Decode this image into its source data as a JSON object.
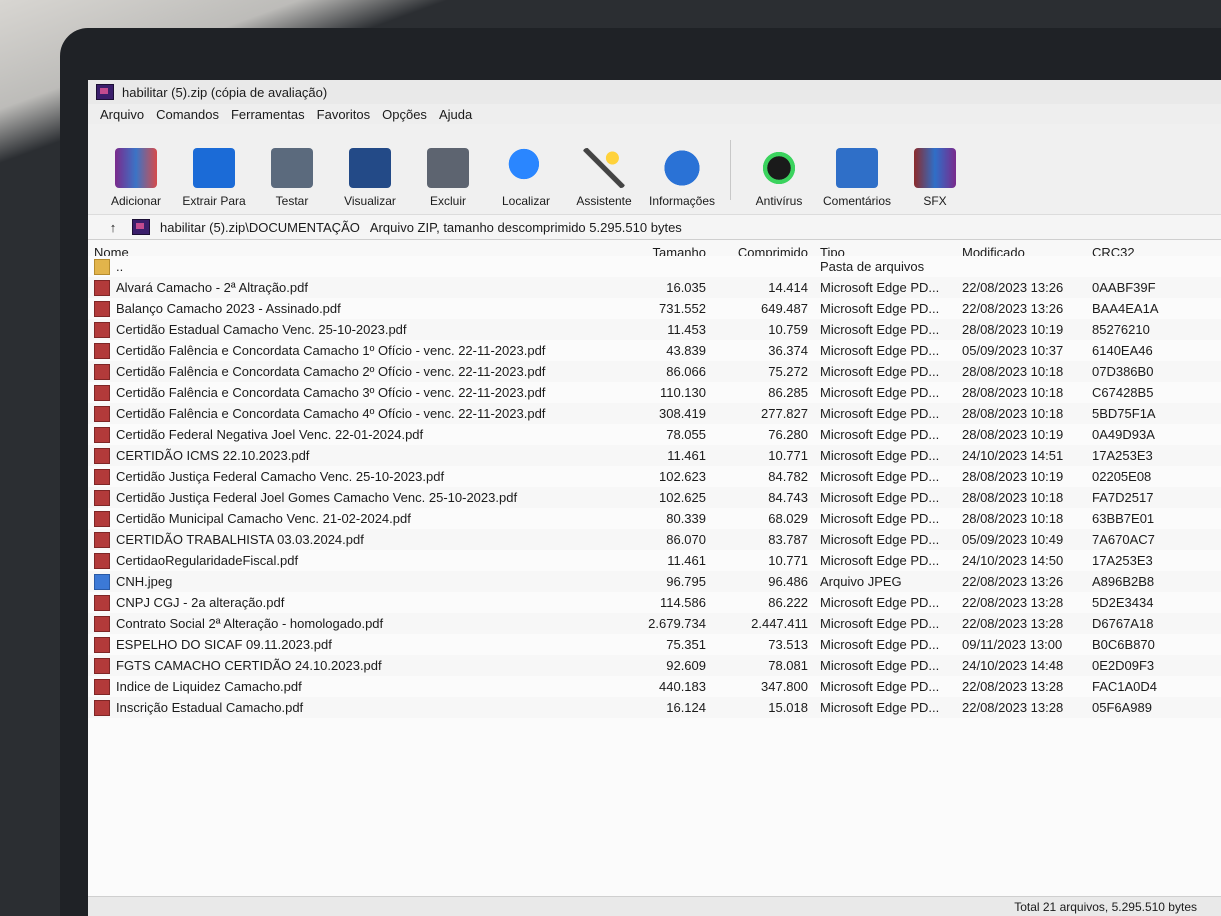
{
  "window": {
    "title": "habilitar (5).zip (cópia de avaliação)"
  },
  "menu": [
    "Arquivo",
    "Comandos",
    "Ferramentas",
    "Favoritos",
    "Opções",
    "Ajuda"
  ],
  "toolbar": [
    {
      "label": "Adicionar",
      "icon": "add-icon"
    },
    {
      "label": "Extrair Para",
      "icon": "extract-icon"
    },
    {
      "label": "Testar",
      "icon": "test-icon"
    },
    {
      "label": "Visualizar",
      "icon": "view-icon"
    },
    {
      "label": "Excluir",
      "icon": "delete-icon"
    },
    {
      "label": "Localizar",
      "icon": "search-icon"
    },
    {
      "label": "Assistente",
      "icon": "wizard-icon"
    },
    {
      "label": "Informações",
      "icon": "info-icon"
    },
    {
      "label": "Antivírus",
      "icon": "antivirus-icon"
    },
    {
      "label": "Comentários",
      "icon": "comment-icon"
    },
    {
      "label": "SFX",
      "icon": "sfx-icon"
    }
  ],
  "path": {
    "location": "habilitar (5).zip\\DOCUMENTAÇÃO",
    "info": "Arquivo ZIP, tamanho descomprimido 5.295.510 bytes"
  },
  "columns": [
    "Nome",
    "Tamanho",
    "Comprimido",
    "Tipo",
    "Modificado",
    "CRC32"
  ],
  "files": [
    {
      "name": "..",
      "size": "",
      "compressed": "",
      "type": "Pasta de arquivos",
      "modified": "",
      "crc": "",
      "kind": "folder"
    },
    {
      "name": "Alvará Camacho - 2ª Altração.pdf",
      "size": "16.035",
      "compressed": "14.414",
      "type": "Microsoft Edge PD...",
      "modified": "22/08/2023 13:26",
      "crc": "0AABF39F",
      "kind": "pdf"
    },
    {
      "name": "Balanço Camacho 2023 - Assinado.pdf",
      "size": "731.552",
      "compressed": "649.487",
      "type": "Microsoft Edge PD...",
      "modified": "22/08/2023 13:26",
      "crc": "BAA4EA1A",
      "kind": "pdf"
    },
    {
      "name": "Certidão Estadual Camacho Venc. 25-10-2023.pdf",
      "size": "11.453",
      "compressed": "10.759",
      "type": "Microsoft Edge PD...",
      "modified": "28/08/2023 10:19",
      "crc": "85276210",
      "kind": "pdf"
    },
    {
      "name": "Certidão Falência e Concordata Camacho 1º Ofício - venc. 22-11-2023.pdf",
      "size": "43.839",
      "compressed": "36.374",
      "type": "Microsoft Edge PD...",
      "modified": "05/09/2023 10:37",
      "crc": "6140EA46",
      "kind": "pdf"
    },
    {
      "name": "Certidão Falência e Concordata Camacho 2º Ofício - venc. 22-11-2023.pdf",
      "size": "86.066",
      "compressed": "75.272",
      "type": "Microsoft Edge PD...",
      "modified": "28/08/2023 10:18",
      "crc": "07D386B0",
      "kind": "pdf"
    },
    {
      "name": "Certidão Falência e Concordata Camacho 3º Ofício - venc. 22-11-2023.pdf",
      "size": "110.130",
      "compressed": "86.285",
      "type": "Microsoft Edge PD...",
      "modified": "28/08/2023 10:18",
      "crc": "C67428B5",
      "kind": "pdf"
    },
    {
      "name": "Certidão Falência e Concordata Camacho 4º Ofício - venc. 22-11-2023.pdf",
      "size": "308.419",
      "compressed": "277.827",
      "type": "Microsoft Edge PD...",
      "modified": "28/08/2023 10:18",
      "crc": "5BD75F1A",
      "kind": "pdf"
    },
    {
      "name": "Certidão Federal Negativa Joel Venc. 22-01-2024.pdf",
      "size": "78.055",
      "compressed": "76.280",
      "type": "Microsoft Edge PD...",
      "modified": "28/08/2023 10:19",
      "crc": "0A49D93A",
      "kind": "pdf"
    },
    {
      "name": "CERTIDÃO ICMS 22.10.2023.pdf",
      "size": "11.461",
      "compressed": "10.771",
      "type": "Microsoft Edge PD...",
      "modified": "24/10/2023 14:51",
      "crc": "17A253E3",
      "kind": "pdf"
    },
    {
      "name": "Certidão Justiça Federal Camacho Venc. 25-10-2023.pdf",
      "size": "102.623",
      "compressed": "84.782",
      "type": "Microsoft Edge PD...",
      "modified": "28/08/2023 10:19",
      "crc": "02205E08",
      "kind": "pdf"
    },
    {
      "name": "Certidão Justiça Federal Joel Gomes Camacho Venc. 25-10-2023.pdf",
      "size": "102.625",
      "compressed": "84.743",
      "type": "Microsoft Edge PD...",
      "modified": "28/08/2023 10:18",
      "crc": "FA7D2517",
      "kind": "pdf"
    },
    {
      "name": "Certidão Municipal Camacho Venc. 21-02-2024.pdf",
      "size": "80.339",
      "compressed": "68.029",
      "type": "Microsoft Edge PD...",
      "modified": "28/08/2023 10:18",
      "crc": "63BB7E01",
      "kind": "pdf"
    },
    {
      "name": "CERTIDÃO TRABALHISTA 03.03.2024.pdf",
      "size": "86.070",
      "compressed": "83.787",
      "type": "Microsoft Edge PD...",
      "modified": "05/09/2023 10:49",
      "crc": "7A670AC7",
      "kind": "pdf"
    },
    {
      "name": "CertidaoRegularidadeFiscal.pdf",
      "size": "11.461",
      "compressed": "10.771",
      "type": "Microsoft Edge PD...",
      "modified": "24/10/2023 14:50",
      "crc": "17A253E3",
      "kind": "pdf"
    },
    {
      "name": "CNH.jpeg",
      "size": "96.795",
      "compressed": "96.486",
      "type": "Arquivo JPEG",
      "modified": "22/08/2023 13:26",
      "crc": "A896B2B8",
      "kind": "jpg"
    },
    {
      "name": "CNPJ CGJ - 2a alteração.pdf",
      "size": "114.586",
      "compressed": "86.222",
      "type": "Microsoft Edge PD...",
      "modified": "22/08/2023 13:28",
      "crc": "5D2E3434",
      "kind": "pdf"
    },
    {
      "name": "Contrato Social 2ª Alteração - homologado.pdf",
      "size": "2.679.734",
      "compressed": "2.447.411",
      "type": "Microsoft Edge PD...",
      "modified": "22/08/2023 13:28",
      "crc": "D6767A18",
      "kind": "pdf"
    },
    {
      "name": "ESPELHO DO SICAF 09.11.2023.pdf",
      "size": "75.351",
      "compressed": "73.513",
      "type": "Microsoft Edge PD...",
      "modified": "09/11/2023 13:00",
      "crc": "B0C6B870",
      "kind": "pdf"
    },
    {
      "name": "FGTS CAMACHO CERTIDÃO 24.10.2023.pdf",
      "size": "92.609",
      "compressed": "78.081",
      "type": "Microsoft Edge PD...",
      "modified": "24/10/2023 14:48",
      "crc": "0E2D09F3",
      "kind": "pdf"
    },
    {
      "name": "Indice de Liquidez Camacho.pdf",
      "size": "440.183",
      "compressed": "347.800",
      "type": "Microsoft Edge PD...",
      "modified": "22/08/2023 13:28",
      "crc": "FAC1A0D4",
      "kind": "pdf"
    },
    {
      "name": "Inscrição Estadual Camacho.pdf",
      "size": "16.124",
      "compressed": "15.018",
      "type": "Microsoft Edge PD...",
      "modified": "22/08/2023 13:28",
      "crc": "05F6A989",
      "kind": "pdf"
    }
  ],
  "status": "Total 21 arquivos, 5.295.510 bytes"
}
